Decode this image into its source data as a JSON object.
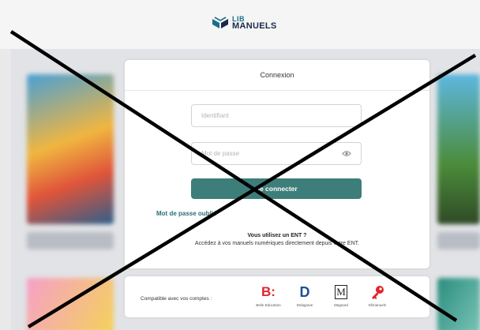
{
  "header": {
    "logo_lib": "LIB",
    "logo_manuels": "MANUELS"
  },
  "login": {
    "title": "Connexion",
    "identifier_placeholder": "Identifiant",
    "password_placeholder": "Mot de passe",
    "submit_label": "Se connecter",
    "forgot_link": "Mot de passe oublié",
    "ent_question": "Vous utilisez un ENT ?",
    "ent_description": "Accédez à vos manuels numériques directement depuis votre ENT."
  },
  "compatible": {
    "label": "Compatible avec vos comptes :",
    "brands": [
      {
        "name": "Belin Education",
        "icon": "belin-b-logo"
      },
      {
        "name": "Delagrave",
        "icon": "delagrave-d-logo"
      },
      {
        "name": "Magnard",
        "icon": "magnard-m-logo"
      },
      {
        "name": "Elimanuels",
        "icon": "key-icon"
      }
    ]
  },
  "colors": {
    "accent": "#3d7e7a",
    "link": "#2a6f73",
    "overlay_x": "#000000"
  }
}
